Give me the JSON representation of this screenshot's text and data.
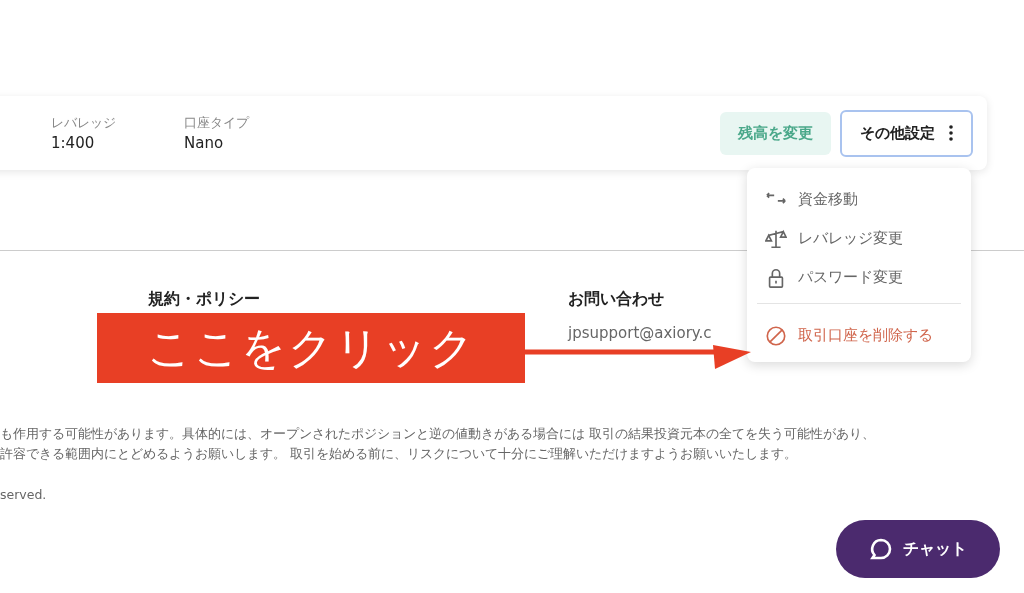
{
  "account_card": {
    "fields": [
      {
        "label": "レバレッジ",
        "value": "1:400"
      },
      {
        "label": "口座タイプ",
        "value": "Nano"
      }
    ],
    "buttons": [
      {
        "kind": "soft",
        "label": "残高を変更"
      },
      {
        "kind": "outline",
        "label": "その他設定",
        "expanded": true
      }
    ]
  },
  "menu": {
    "items": [
      {
        "kind": "transfer",
        "label": "資金移動",
        "danger": false
      },
      {
        "kind": "leverage",
        "label": "レバレッジ変更",
        "danger": false
      },
      {
        "kind": "password",
        "label": "パスワード変更",
        "danger": false
      },
      {
        "kind": "delete",
        "label": "取引口座を削除する",
        "danger": true
      }
    ]
  },
  "footer": {
    "columns": [
      {
        "heading": "規約・ポリシー"
      },
      {
        "heading": "お問い合わせ",
        "link": "jpsupport@axiory.c"
      }
    ],
    "disclaimer": [
      "も作用する可能性があります。具体的には、オープンされたポジションと逆の値動きがある場合には 取引の結果投資元本の全てを失う可能性があり、",
      "許容できる範囲内にとどめるようお願いします。 取引を始める前に、リスクについて十分にご理解いただけますようお願いいたします。"
    ],
    "copyright": "served."
  },
  "chat_button": {
    "label": "チャット"
  },
  "annotation": {
    "label": "ここをクリック"
  }
}
